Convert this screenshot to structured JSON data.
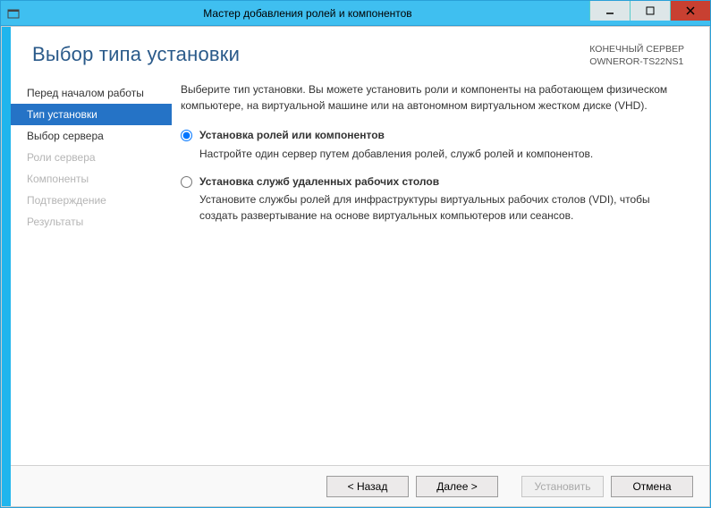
{
  "titlebar": {
    "title": "Мастер добавления ролей и компонентов"
  },
  "header": {
    "page_title": "Выбор типа установки",
    "dest_label": "КОНЕЧНЫЙ СЕРВЕР",
    "dest_server": "OWNEROR-TS22NS1"
  },
  "sidebar": {
    "items": [
      {
        "label": "Перед началом работы"
      },
      {
        "label": "Тип установки"
      },
      {
        "label": "Выбор сервера"
      },
      {
        "label": "Роли сервера"
      },
      {
        "label": "Компоненты"
      },
      {
        "label": "Подтверждение"
      },
      {
        "label": "Результаты"
      }
    ]
  },
  "pane": {
    "intro": "Выберите тип установки. Вы можете установить роли и компоненты на работающем физическом компьютере, на виртуальной машине или на автономном виртуальном жестком диске (VHD).",
    "option1_title": "Установка ролей или компонентов",
    "option1_desc": "Настройте один сервер путем добавления ролей, служб ролей и компонентов.",
    "option2_title": "Установка служб удаленных рабочих столов",
    "option2_desc": "Установите службы ролей для инфраструктуры виртуальных рабочих столов (VDI), чтобы создать развертывание на основе виртуальных компьютеров или сеансов."
  },
  "footer": {
    "back": "< Назад",
    "next": "Далее >",
    "install": "Установить",
    "cancel": "Отмена"
  }
}
